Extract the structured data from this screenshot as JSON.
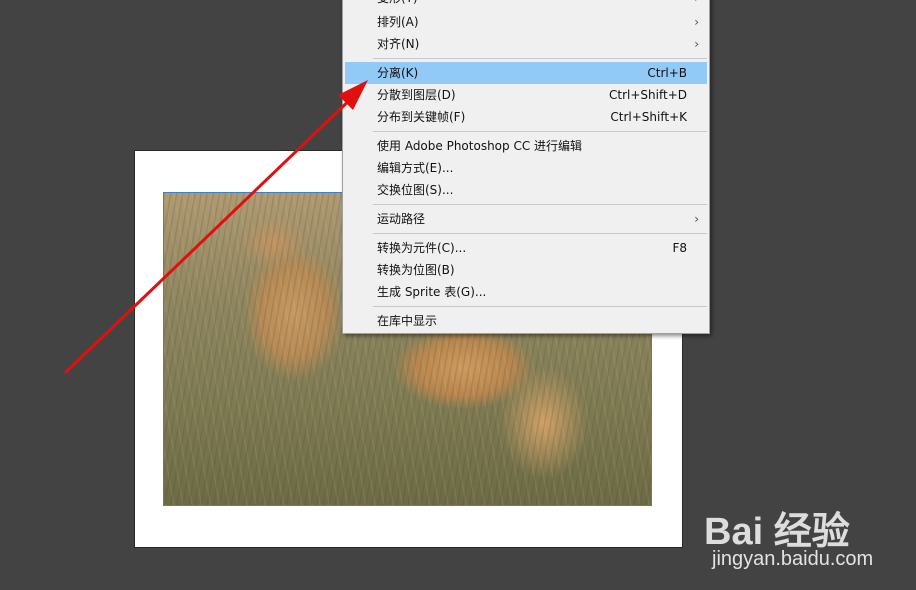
{
  "menu": {
    "items": [
      {
        "label": "变形(T)",
        "shortcut": "",
        "submenu": true
      },
      {
        "label": "排列(A)",
        "shortcut": "",
        "submenu": true
      },
      {
        "label": "对齐(N)",
        "shortcut": "",
        "submenu": true
      },
      {
        "label": "分离(K)",
        "shortcut": "Ctrl+B",
        "submenu": false,
        "highlighted": true
      },
      {
        "label": "分散到图层(D)",
        "shortcut": "Ctrl+Shift+D",
        "submenu": false
      },
      {
        "label": "分布到关键帧(F)",
        "shortcut": "Ctrl+Shift+K",
        "submenu": false
      },
      {
        "label": "使用 Adobe Photoshop CC 进行编辑",
        "shortcut": "",
        "submenu": false
      },
      {
        "label": "编辑方式(E)...",
        "shortcut": "",
        "submenu": false
      },
      {
        "label": "交换位图(S)...",
        "shortcut": "",
        "submenu": false
      },
      {
        "label": "运动路径",
        "shortcut": "",
        "submenu": true
      },
      {
        "label": "转换为元件(C)...",
        "shortcut": "F8",
        "submenu": false
      },
      {
        "label": "转换为位图(B)",
        "shortcut": "",
        "submenu": false
      },
      {
        "label": "生成 Sprite 表(G)...",
        "shortcut": "",
        "submenu": false
      },
      {
        "label": "在库中显示",
        "shortcut": "",
        "submenu": false
      }
    ],
    "submenu_arrow": "›"
  },
  "colors": {
    "canvas_bg": "#434343",
    "menu_bg": "#f0f0f0",
    "highlight": "#91c9f7",
    "selection_border": "#3d7fc8",
    "annotation_arrow": "#e01010"
  },
  "watermark": {
    "logo_text": "Bai 经验",
    "url_text": "jingyan.baidu.com"
  },
  "icons": {
    "annotation": "red-arrow-icon",
    "watermark": "baidu-paw-icon"
  }
}
